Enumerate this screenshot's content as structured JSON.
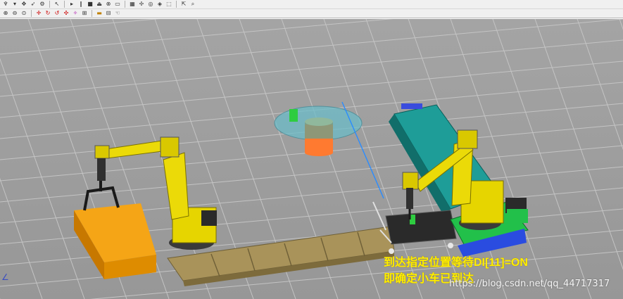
{
  "toolbar1": {
    "icons": [
      "robot-icon",
      "dropdown-icon",
      "move-icon",
      "pointer-icon",
      "gear-icon",
      "cursor-icon",
      "play-icon",
      "pause-icon",
      "stop-icon",
      "eject-icon",
      "close-icon",
      "window-icon",
      "table-icon",
      "cross-icon",
      "target-icon",
      "camera-icon",
      "frame-icon",
      "export-icon",
      "search-icon"
    ]
  },
  "toolbar2": {
    "icons": [
      "zoom-in-icon",
      "zoom-out-icon",
      "zoom-fit-icon",
      "rotate-x-icon",
      "rotate-y-icon",
      "rotate-z-icon",
      "pan-icon",
      "snap-icon",
      "grid-icon",
      "measure-icon",
      "ruler-icon",
      "hand-icon"
    ]
  },
  "viewport": {
    "overlay_line1": "到达指定位置等待DI[11]=ON",
    "overlay_line2": "即确定小车已到达",
    "watermark": "https://blog.csdn.net/qq_44717317",
    "corner_mark": "∠"
  },
  "colors": {
    "robot": "#e6d500",
    "floor": "#a0a0a0",
    "grid_line": "#c8c8c8",
    "conveyor": "#b19a5a",
    "box": "#e59500",
    "table": "#2aa8a0",
    "base_green": "#22c04a",
    "overlay_text": "#ffee00"
  }
}
